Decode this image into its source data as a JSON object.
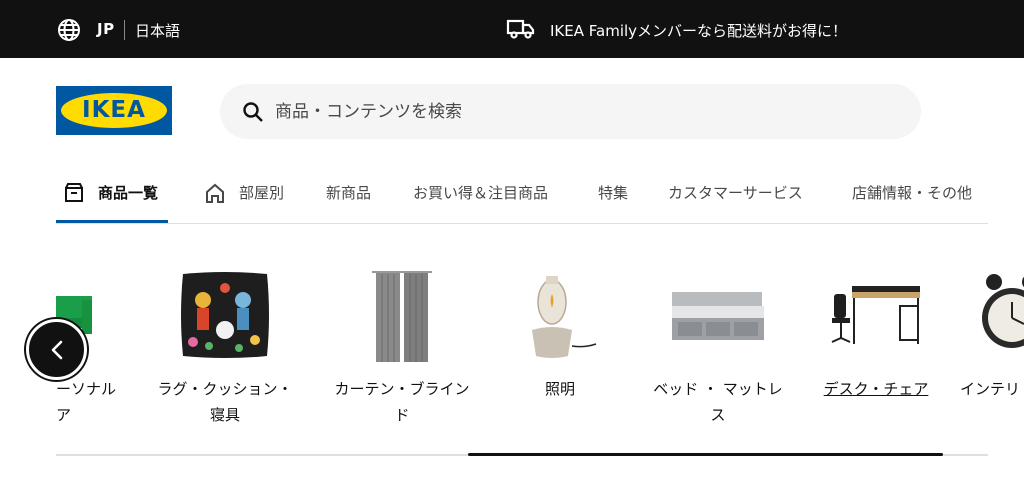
{
  "topbar": {
    "country": "JP",
    "language": "日本語",
    "promo": "IKEA Familyメンバーなら配送料がお得に！"
  },
  "brand": {
    "logo_text": "IKEA",
    "blue": "#0058a3",
    "yellow": "#ffdb00"
  },
  "search": {
    "placeholder": "商品・コンテンツを検索"
  },
  "nav": {
    "items": [
      {
        "label": "商品一覧",
        "icon": "box-icon",
        "active": true
      },
      {
        "label": "部屋別",
        "icon": "home-icon",
        "active": false
      },
      {
        "label": "新商品",
        "active": false
      },
      {
        "label": "お買い得＆注目商品",
        "active": false
      },
      {
        "label": "特集",
        "active": false
      },
      {
        "label": "カスタマーサービス",
        "active": false
      },
      {
        "label": "店舗情報・その他",
        "active": false
      }
    ]
  },
  "categories": [
    {
      "line1": "ーソナル",
      "line2": "ア"
    },
    {
      "line1": "ラグ・クッション・",
      "line2": "寝具"
    },
    {
      "line1": "カーテン・ブライン",
      "line2": "ド"
    },
    {
      "line1": "照明",
      "line2": ""
    },
    {
      "line1": "ベッド ・ マットレ",
      "line2": "ス"
    },
    {
      "line1": "デスク・チェア",
      "line2": ""
    },
    {
      "line1": "インテリ",
      "line2": ""
    }
  ],
  "carousel": {
    "prev_icon": "chevron-left-icon",
    "scroll_position": 0.44
  }
}
